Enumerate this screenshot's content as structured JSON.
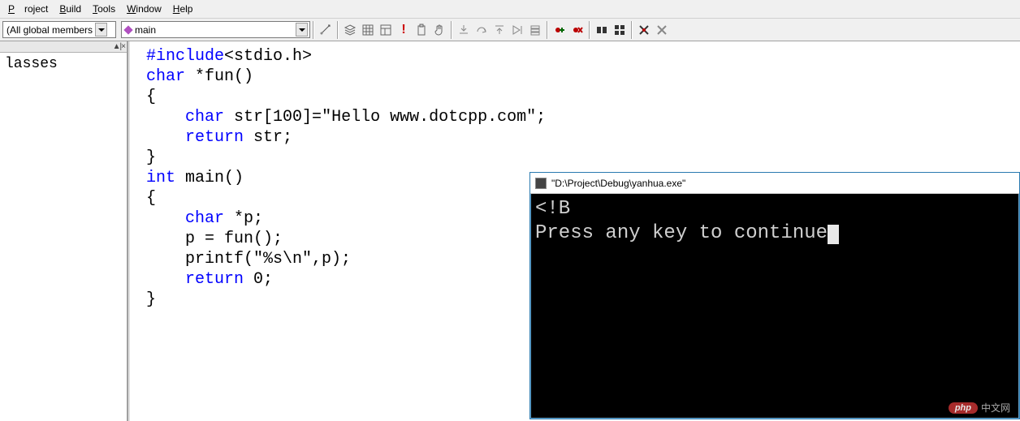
{
  "menu": {
    "project": "Project",
    "build": "Build",
    "tools": "Tools",
    "window": "Window",
    "help": "Help"
  },
  "toolbar": {
    "combo_scope": "(All global members",
    "combo_func": "main",
    "icons": [
      "wizard-icon",
      "tile-icon",
      "layers-icon",
      "grid-icon",
      "layout-icon",
      "alert-icon",
      "clipboard-icon",
      "hand-icon",
      "step-into-icon",
      "step-over-icon",
      "step-out-icon",
      "run-to-cursor-icon",
      "callstack-icon",
      "breakpoint-add-icon",
      "breakpoint-remove-icon",
      "watch-icon",
      "memory-icon",
      "registers-icon",
      "disasm-icon"
    ]
  },
  "sidebar": {
    "head_ctrl": "▲|×",
    "label": "lasses"
  },
  "code": {
    "tokens": [
      [
        [
          "pp",
          "#include"
        ],
        [
          "norm",
          "<stdio.h>"
        ]
      ],
      [
        [
          "kw",
          "char"
        ],
        [
          "norm",
          " *fun()"
        ]
      ],
      [
        [
          "norm",
          "{"
        ]
      ],
      [
        [
          "norm",
          "    "
        ],
        [
          "kw",
          "char"
        ],
        [
          "norm",
          " str[100]="
        ],
        [
          "norm",
          "\"Hello www.dotcpp.com\""
        ],
        [
          "norm",
          ";"
        ]
      ],
      [
        [
          "norm",
          "    "
        ],
        [
          "kw",
          "return"
        ],
        [
          "norm",
          " str;"
        ]
      ],
      [
        [
          "norm",
          "}"
        ]
      ],
      [
        [
          "kw",
          "int"
        ],
        [
          "norm",
          " main()"
        ]
      ],
      [
        [
          "norm",
          "{"
        ]
      ],
      [
        [
          "norm",
          "    "
        ],
        [
          "kw",
          "char"
        ],
        [
          "norm",
          " *p;"
        ]
      ],
      [
        [
          "norm",
          "    p = fun();"
        ]
      ],
      [
        [
          "norm",
          "    printf("
        ],
        [
          "norm",
          "\"%s\\n\""
        ],
        [
          "norm",
          ",p);"
        ]
      ],
      [
        [
          "norm",
          "    "
        ],
        [
          "kw",
          "return"
        ],
        [
          "norm",
          " 0;"
        ]
      ],
      [
        [
          "norm",
          "}"
        ]
      ]
    ]
  },
  "console": {
    "title": "\"D:\\Project\\Debug\\yanhua.exe\"",
    "line1": "<!B",
    "line2": "Press any key to continue"
  },
  "watermark": {
    "pill": "php",
    "txt": "中文网"
  }
}
